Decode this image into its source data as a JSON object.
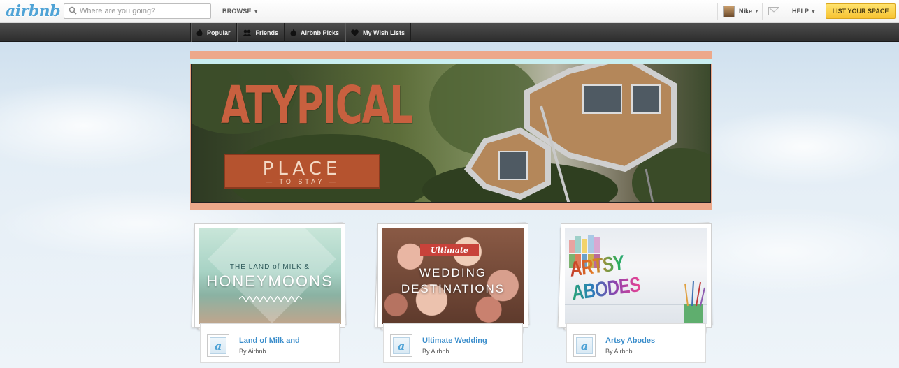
{
  "header": {
    "logo": "airbnb",
    "search_placeholder": "Where are you going?",
    "browse_label": "BROWSE",
    "user_name": "Nike",
    "help_label": "HELP",
    "list_space_label": "LIST YOUR SPACE"
  },
  "nav": {
    "items": [
      {
        "label": "Popular",
        "icon": "flame-icon"
      },
      {
        "label": "Friends",
        "icon": "friends-icon"
      },
      {
        "label": "Airbnb Picks",
        "icon": "flame-icon"
      },
      {
        "label": "My Wish Lists",
        "icon": "heart-icon"
      }
    ]
  },
  "hero": {
    "title": "ATYPICAL",
    "plaque_main": "PLACE",
    "plaque_sub": "— TO STAY —"
  },
  "cards": [
    {
      "title": "Land of Milk and",
      "by": "By Airbnb",
      "badge": "a",
      "art_line1": "THE LAND of MILK & ",
      "art_line2": "HONEYMOONS"
    },
    {
      "title": "Ultimate Wedding",
      "by": "By Airbnb",
      "badge": "a",
      "art_ribbon": "Ultimate",
      "art_line1": "WEDDING",
      "art_line2": "DESTINATIONS"
    },
    {
      "title": "Artsy Abodes",
      "by": "By Airbnb",
      "badge": "a",
      "art_word": "ARTSY ABODES"
    }
  ],
  "colors": {
    "brand_blue": "#4fa3d6",
    "list_space_yellow": "#f7c331",
    "hero_frame": "#eda88a",
    "hero_title": "#c8603f"
  }
}
